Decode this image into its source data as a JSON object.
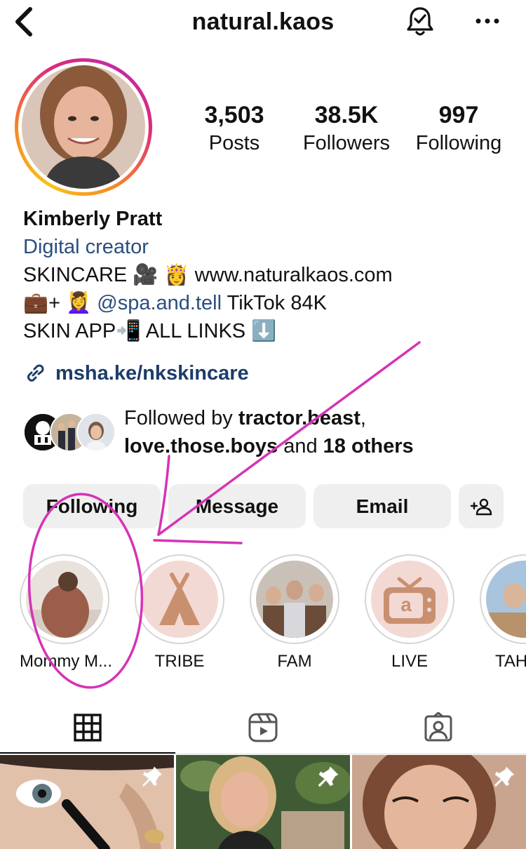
{
  "header": {
    "username": "natural.kaos"
  },
  "stats": {
    "posts": {
      "value": "3,503",
      "label": "Posts"
    },
    "followers": {
      "value": "38.5K",
      "label": "Followers"
    },
    "following": {
      "value": "997",
      "label": "Following"
    }
  },
  "bio": {
    "name": "Kimberly Pratt",
    "category": "Digital creator",
    "line1_a": "SKINCARE 🎥 👸 ",
    "line1_b": "www.naturalkaos.com",
    "line2_a": "💼+ 💆‍♀️ ",
    "line2_mention": "@spa.and.tell",
    "line2_b": " TikTok 84K",
    "line3": "SKIN APP📲 ALL LINKS ⬇️"
  },
  "link": {
    "text": "msha.ke/nkskincare"
  },
  "followed_by": {
    "prefix": "Followed by ",
    "user1": "tractor.beast",
    "comma": ",",
    "user2": "love.those.boys",
    "middle": " and ",
    "others": "18 others"
  },
  "buttons": {
    "following": "Following",
    "message": "Message",
    "email": "Email"
  },
  "highlights": [
    {
      "label": "Mommy M..."
    },
    {
      "label": "TRIBE"
    },
    {
      "label": "FAM"
    },
    {
      "label": "LIVE"
    },
    {
      "label": "TAH"
    }
  ],
  "tabs": [
    {
      "icon": "grid-icon",
      "active": true
    },
    {
      "icon": "reels-icon",
      "active": false
    },
    {
      "icon": "tagged-icon",
      "active": false
    }
  ],
  "colors": {
    "link_blue": "#1c3d6b",
    "annotation_magenta": "#d633b5",
    "button_bg": "#efefef",
    "tribe_bg": "#f3d9d4",
    "tribe_icon": "#c99070"
  }
}
